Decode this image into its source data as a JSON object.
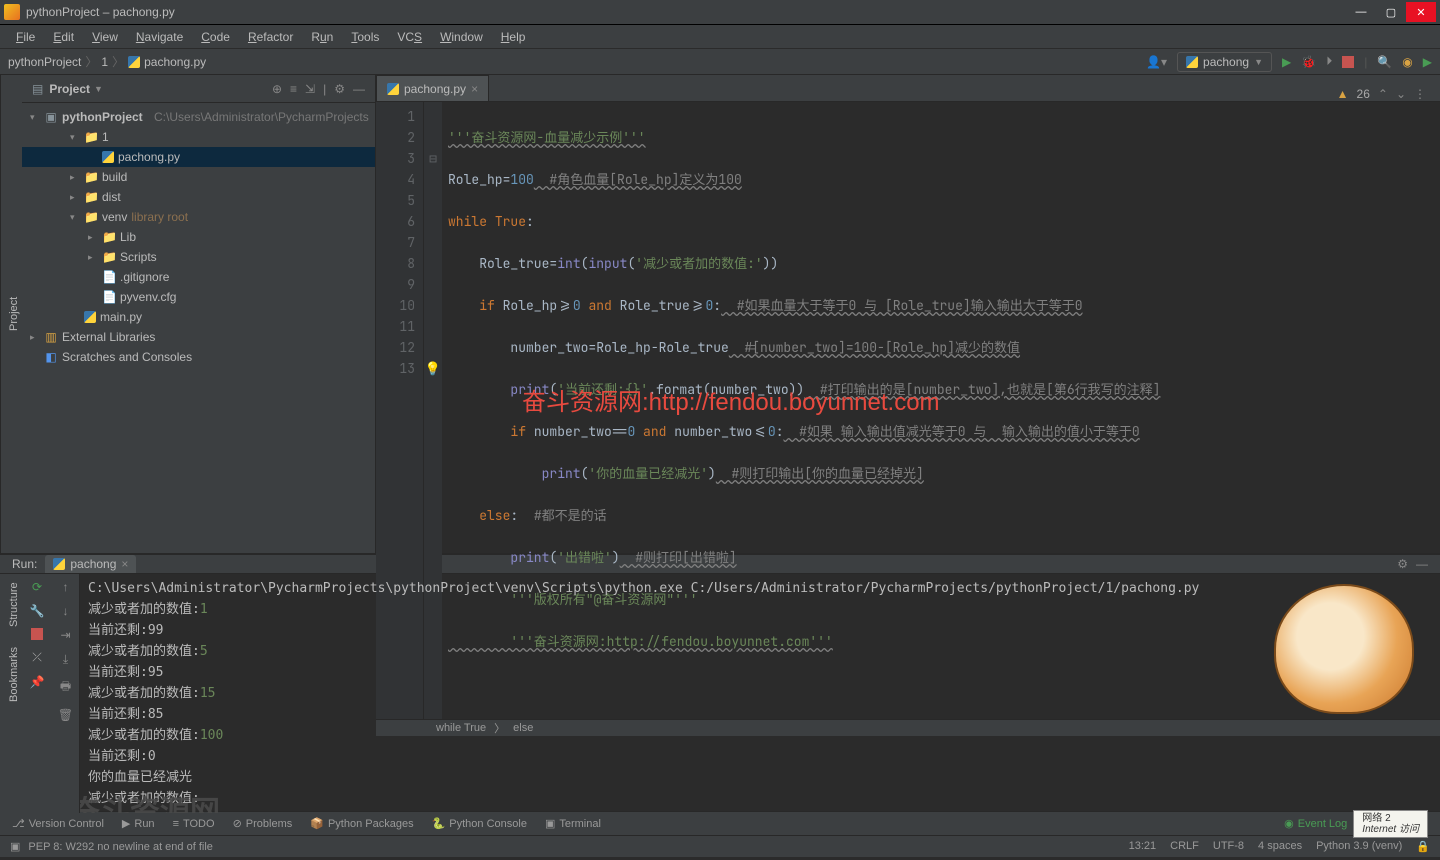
{
  "window": {
    "title": "pythonProject – pachong.py"
  },
  "menu": [
    "File",
    "Edit",
    "View",
    "Navigate",
    "Code",
    "Refactor",
    "Run",
    "Tools",
    "VCS",
    "Window",
    "Help"
  ],
  "breadcrumb": {
    "root": "pythonProject",
    "mid": "1",
    "file": "pachong.py"
  },
  "runconfig": {
    "name": "pachong"
  },
  "project": {
    "title": "Project",
    "root": {
      "name": "pythonProject",
      "path": "C:\\Users\\Administrator\\PycharmProjects"
    },
    "items": [
      {
        "depth": 1,
        "arrow": "▾",
        "icon": "📁",
        "label": "1"
      },
      {
        "depth": 2,
        "arrow": "",
        "icon": "py",
        "label": "pachong.py",
        "selected": true
      },
      {
        "depth": 1,
        "arrow": "▸",
        "icon": "📁",
        "label": "build"
      },
      {
        "depth": 1,
        "arrow": "▸",
        "icon": "📁",
        "label": "dist"
      },
      {
        "depth": 1,
        "arrow": "▾",
        "icon": "📁",
        "label": "venv",
        "note": "library root"
      },
      {
        "depth": 2,
        "arrow": "▸",
        "icon": "📁",
        "label": "Lib"
      },
      {
        "depth": 2,
        "arrow": "▸",
        "icon": "📁",
        "label": "Scripts"
      },
      {
        "depth": 2,
        "arrow": "",
        "icon": "📄",
        "label": ".gitignore"
      },
      {
        "depth": 2,
        "arrow": "",
        "icon": "📄",
        "label": "pyvenv.cfg"
      },
      {
        "depth": 1,
        "arrow": "",
        "icon": "py",
        "label": "main.py"
      }
    ],
    "external": "External Libraries",
    "scratches": "Scratches and Consoles"
  },
  "editor": {
    "tab": "pachong.py",
    "warnings": "26",
    "lines": [
      "1",
      "2",
      "3",
      "4",
      "5",
      "6",
      "7",
      "8",
      "9",
      "10",
      "11",
      "12",
      "13"
    ],
    "code": {
      "l1a": "'''奋斗资源网-血量减少示例'''",
      "l2a": "Role_hp",
      "l2b": "=",
      "l2c": "100",
      "l2d": "  #角色血量[Role_hp]定义为100",
      "l3a": "while ",
      "l3b": "True",
      "l3c": ":",
      "l4a": "    Role_true",
      "l4b": "=",
      "l4c": "int",
      "l4d": "(",
      "l4e": "input",
      "l4f": "(",
      "l4g": "'减少或者加的数值:'",
      "l4h": "))",
      "l5a": "    if ",
      "l5b": "Role_hp",
      "l5c": ">=",
      "l5d": "0",
      "l5e": " and ",
      "l5f": "Role_true",
      "l5g": ">=",
      "l5h": "0",
      "l5i": ":",
      "l5j": "  #如果血量大于等于0 与 [Role_true]输入输出大于等于0",
      "l6a": "        number_two",
      "l6b": "=",
      "l6c": "Role_hp-Role_true",
      "l6d": "  #[number_two]=100-[Role_hp]减少的数值",
      "l7a": "        print",
      "l7b": "(",
      "l7c": "'当前还剩:{}'",
      "l7d": ".format(number_two))",
      "l7e": "  #打印输出的是[number_two],也就是[第6行我写的注释]",
      "l8a": "        if ",
      "l8b": "number_two",
      "l8c": "==",
      "l8d": "0",
      "l8e": " and ",
      "l8f": "number_two",
      "l8g": "<=",
      "l8h": "0",
      "l8i": ":",
      "l8j": "  #如果 输入输出值减光等于0 与  输入输出的值小于等于0",
      "l9a": "            print",
      "l9b": "(",
      "l9c": "'你的血量已经减光'",
      "l9d": ")",
      "l9e": "  #则打印输出[你的血量已经掉光]",
      "l10a": "    else",
      "l10b": ":",
      "l10c": "  #都不是的话",
      "l11a": "        print",
      "l11b": "(",
      "l11c": "'出错啦'",
      "l11d": ")",
      "l11e": "  #则打印[出错啦]",
      "l12a": "        '''版权所有\"@奋斗资源网\"'''",
      "l13a": "        '''奋斗资源网:http://fendou.boyunnet.com'''"
    },
    "watermark": "奋斗资源网:http://fendou.boyunnet.com",
    "crumbs": [
      "while True",
      "else"
    ]
  },
  "run": {
    "label": "Run:",
    "tab": "pachong",
    "cmd": "C:\\Users\\Administrator\\PycharmProjects\\pythonProject\\venv\\Scripts\\python.exe C:/Users/Administrator/PycharmProjects/pythonProject/1/pachong.py",
    "lines": [
      {
        "t": "减少或者加的数值:",
        "v": "1"
      },
      {
        "t": "当前还剩:99",
        "v": ""
      },
      {
        "t": "减少或者加的数值:",
        "v": "5"
      },
      {
        "t": "当前还剩:95",
        "v": ""
      },
      {
        "t": "减少或者加的数值:",
        "v": "15"
      },
      {
        "t": "当前还剩:85",
        "v": ""
      },
      {
        "t": "减少或者加的数值:",
        "v": "100"
      },
      {
        "t": "当前还剩:0",
        "v": ""
      },
      {
        "t": "你的血量已经减光",
        "v": ""
      },
      {
        "t": "减少或者加的数值:",
        "v": ""
      }
    ],
    "wm2": "奋斗资源网"
  },
  "bottom": {
    "tools": [
      "Version Control",
      "Run",
      "TODO",
      "Problems",
      "Python Packages",
      "Python Console",
      "Terminal"
    ],
    "eventlog": "Event Log",
    "net1": "网络 2",
    "net2": "Internet 访问"
  },
  "status": {
    "msg": "PEP 8: W292 no newline at end of file",
    "pos": "13:21",
    "le": "CRLF",
    "enc": "UTF-8",
    "indent": "4 spaces",
    "py": "Python 3.9 (venv)",
    "lock": "🔒"
  },
  "sidetabs": {
    "project": "Project",
    "structure": "Structure",
    "bookmarks": "Bookmarks"
  }
}
